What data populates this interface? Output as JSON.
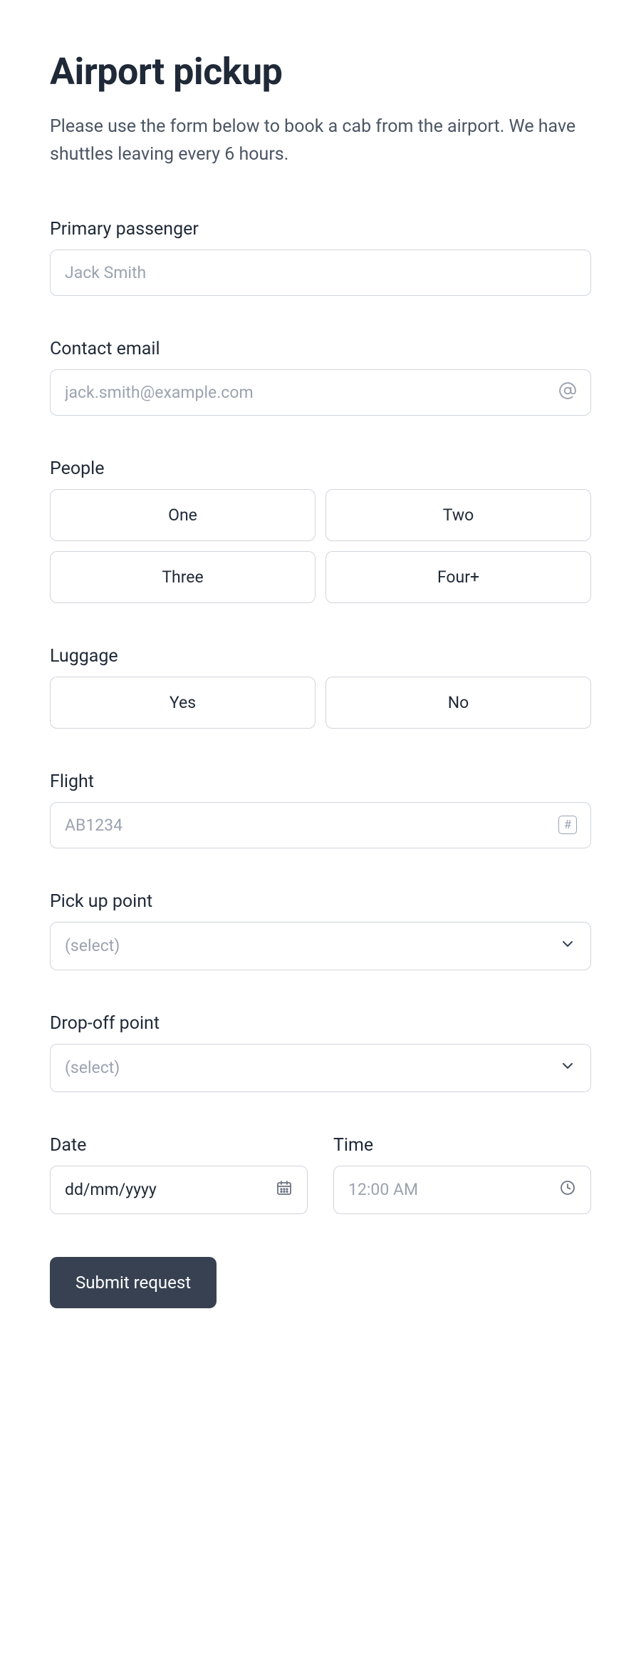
{
  "header": {
    "title": "Airport pickup",
    "description": "Please use the form below to book a cab from the airport. We have shuttles leaving every 6 hours."
  },
  "fields": {
    "primary_passenger": {
      "label": "Primary passenger",
      "placeholder": "Jack Smith"
    },
    "contact_email": {
      "label": "Contact email",
      "placeholder": "jack.smith@example.com"
    },
    "people": {
      "label": "People",
      "options": [
        "One",
        "Two",
        "Three",
        "Four+"
      ]
    },
    "luggage": {
      "label": "Luggage",
      "options": [
        "Yes",
        "No"
      ]
    },
    "flight": {
      "label": "Flight",
      "placeholder": "AB1234"
    },
    "pickup": {
      "label": "Pick up point",
      "placeholder": "(select)"
    },
    "dropoff": {
      "label": "Drop-off point",
      "placeholder": "(select)"
    },
    "date": {
      "label": "Date",
      "placeholder": "dd/mm/yyyy"
    },
    "time": {
      "label": "Time",
      "placeholder": "12:00 AM"
    }
  },
  "submit": {
    "label": "Submit request"
  }
}
